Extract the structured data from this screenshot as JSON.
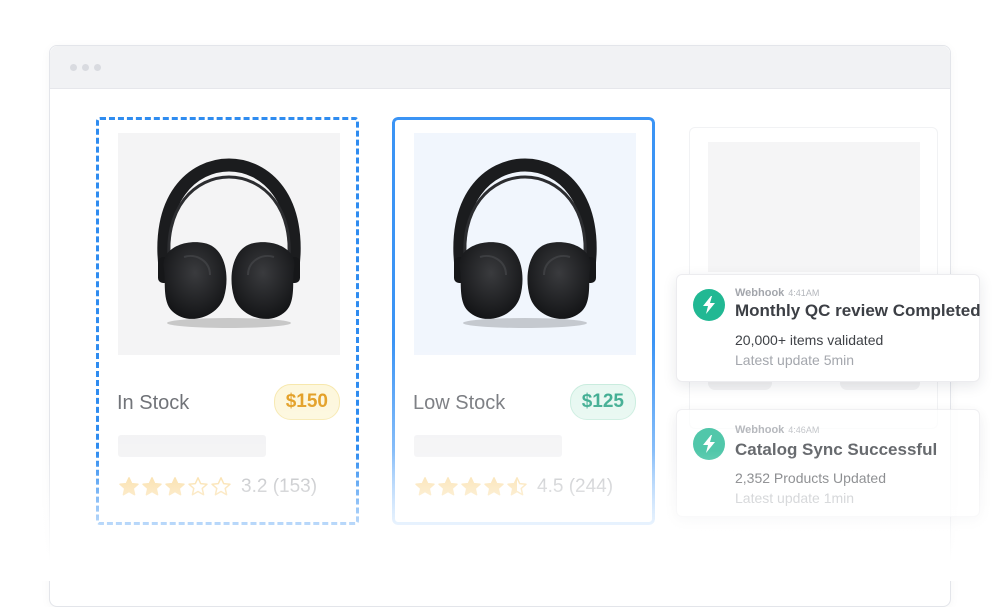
{
  "window": {
    "titlebar_dots": 3
  },
  "products": [
    {
      "stock_label": "In Stock",
      "price": "$150",
      "rating_value": 3.2,
      "rating_text": "3.2 (153)",
      "image": "headphones-image",
      "style": "dashed-selection"
    },
    {
      "stock_label": "Low Stock",
      "price": "$125",
      "rating_value": 4.5,
      "rating_text": "4.5 (244)",
      "image": "headphones-image",
      "style": "solid-selection"
    }
  ],
  "notifications": [
    {
      "source": "Webhook",
      "time": "4:41AM",
      "title": "Monthly QC review Completed",
      "line1": "20,000+ items validated",
      "line2": "Latest update 5min",
      "icon": "lightning-bolt-icon"
    },
    {
      "source": "Webhook",
      "time": "4:46AM",
      "title": "Catalog Sync Successful",
      "line1": "2,352 Products Updated",
      "line2": "Latest update 1min",
      "icon": "lightning-bolt-icon"
    }
  ],
  "colors": {
    "accent_blue": "#2f8cf0",
    "star_gold": "#f6c25a",
    "price_gold": "#e0940c",
    "price_green": "#169b7a",
    "bolt_green": "#21b893"
  }
}
